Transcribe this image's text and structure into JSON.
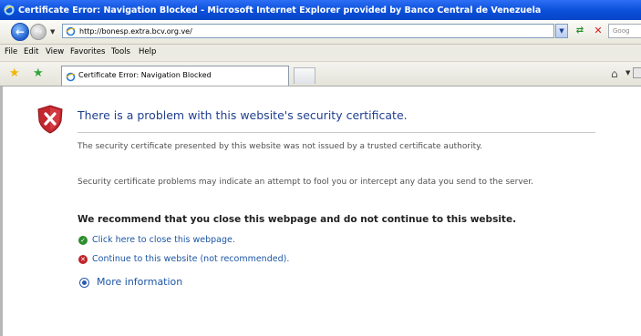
{
  "window": {
    "title": "Certificate Error: Navigation Blocked - Microsoft Internet Explorer provided by Banco Central de Venezuela"
  },
  "address_bar": {
    "url": "http://bonesp.extra.bcv.org.ve/",
    "search_placeholder": "Goog"
  },
  "menu": {
    "items": [
      "File",
      "Edit",
      "View",
      "Favorites",
      "Tools",
      "Help"
    ]
  },
  "tab": {
    "label": "Certificate Error: Navigation Blocked"
  },
  "content": {
    "heading": "There is a problem with this website's security certificate.",
    "paragraph1": "The security certificate presented by this website was not issued by a trusted certificate authority.",
    "paragraph2": "Security certificate problems may indicate an attempt to fool you or intercept any data you send to the server.",
    "recommendation": "We recommend that you close this webpage and do not continue to this website.",
    "close_link": "Click here to close this webpage.",
    "continue_link": "Continue to this website (not recommended).",
    "more_info": "More information"
  },
  "colors": {
    "titlebar": "#0a4fd8",
    "heading": "#1f3f8f",
    "link": "#1d56a5"
  }
}
